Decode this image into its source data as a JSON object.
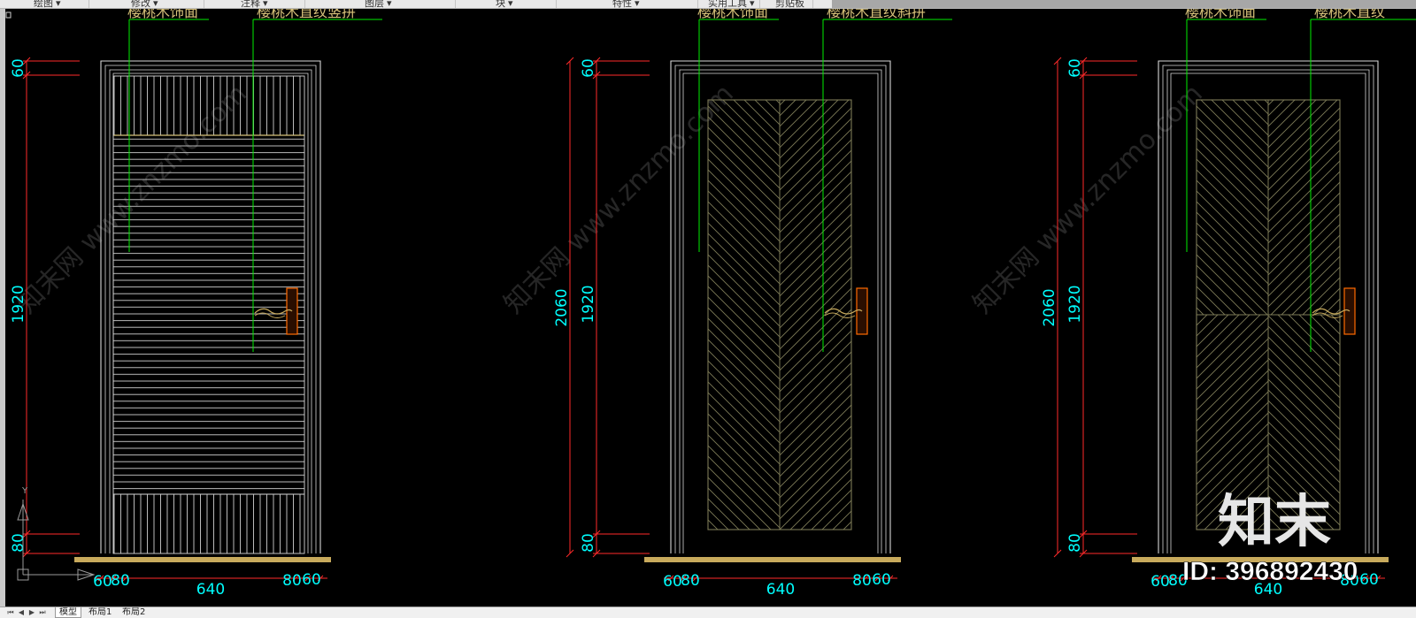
{
  "ribbon": {
    "panels": [
      "绘图",
      "修改",
      "注释",
      "图层",
      "块",
      "特性",
      "实用工具",
      "剪贴板"
    ]
  },
  "tabs": {
    "items": [
      "模型",
      "布局1",
      "布局2"
    ],
    "active": "模型"
  },
  "drawing": {
    "doors": [
      {
        "callouts": [
          "樱桃木饰面",
          "樱桃木直纹竖拼"
        ],
        "dims_vertical_inner": [
          "60",
          "1920",
          "80"
        ],
        "dims_vertical_outer": "",
        "dims_horizontal": [
          "60",
          "80",
          "640",
          "80",
          "60"
        ],
        "panel_style": "vertical-horizontal-stripes"
      },
      {
        "callouts": [
          "樱桃木饰面",
          "樱桃木直纹斜拼"
        ],
        "dims_vertical_inner": [
          "60",
          "1920",
          "80"
        ],
        "dims_vertical_outer": "2060",
        "dims_horizontal": [
          "60",
          "80",
          "640",
          "80",
          "60"
        ],
        "panel_style": "herringbone-diagonal"
      },
      {
        "callouts": [
          "樱桃木饰面",
          "樱桃木直纹"
        ],
        "dims_vertical_inner": [
          "60",
          "1920",
          "80"
        ],
        "dims_vertical_outer": "2060",
        "dims_horizontal": [
          "60",
          "80",
          "640",
          "80",
          "60"
        ],
        "panel_style": "herringbone-four-quadrant"
      }
    ],
    "watermark": "知末网 www.znzmo.com",
    "brand_logo": "知末",
    "id_label": "ID: 396892430"
  },
  "colors": {
    "background": "#000000",
    "door_lines": "#d8d8d8",
    "dimension_lines": "#ff2a2a",
    "dimension_text": "#00ffff",
    "callout_lines": "#00ee00",
    "callout_text": "#d8c27a",
    "floor_strip": "#c8aa5c",
    "hatch": "#7d7a56",
    "handle": "#ff6a00"
  }
}
